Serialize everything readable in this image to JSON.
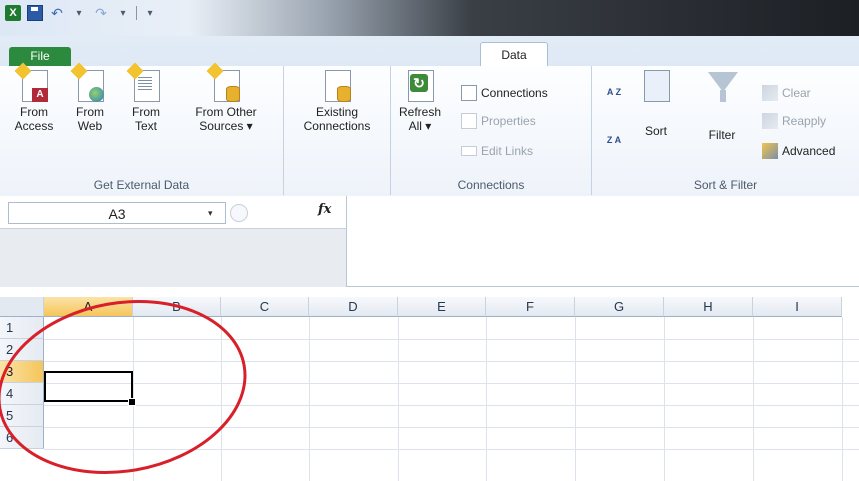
{
  "quick_access": {
    "logo": "X",
    "undo_glyph": "↶",
    "redo_glyph": "↷",
    "dropdown_glyph": "▾"
  },
  "tabs": {
    "file": "File",
    "data": "Data"
  },
  "ribbon": {
    "get_external_data": {
      "label": "Get External Data",
      "buttons": [
        {
          "line1": "From",
          "line2": "Access",
          "icon": "access-icon"
        },
        {
          "line1": "From",
          "line2": "Web",
          "icon": "web-icon"
        },
        {
          "line1": "From",
          "line2": "Text",
          "icon": "text-icon"
        },
        {
          "line1": "From Other",
          "line2": "Sources ▾",
          "icon": "other-sources-icon"
        }
      ]
    },
    "existing": {
      "line1": "Existing",
      "line2": "Connections"
    },
    "connections": {
      "label": "Connections",
      "refresh_line1": "Refresh",
      "refresh_line2": "All ▾",
      "refresh_glyph": "↻",
      "connections": "Connections",
      "properties": "Properties",
      "edit_links": "Edit Links"
    },
    "sort_filter": {
      "label": "Sort & Filter",
      "sort_az": "A Z",
      "sort_za": "Z A",
      "sort": "Sort",
      "filter": "Filter",
      "clear": "Clear",
      "reapply": "Reapply",
      "advanced": "Advanced"
    }
  },
  "formula_bar": {
    "name_box": "A3",
    "dropdown": "▾",
    "fx": "fx",
    "formula": ""
  },
  "sheet": {
    "columns": [
      "A",
      "B",
      "C",
      "D",
      "E",
      "F",
      "G",
      "H",
      "I"
    ],
    "rows": [
      "1",
      "2",
      "3",
      "4",
      "5",
      "6"
    ],
    "selected_column": "A",
    "selected_row": "3",
    "active_cell": "A3"
  },
  "colors": {
    "file_tab": "#2b8a3e",
    "selection_header": "#f5c55a",
    "annotation": "#d8202a"
  }
}
